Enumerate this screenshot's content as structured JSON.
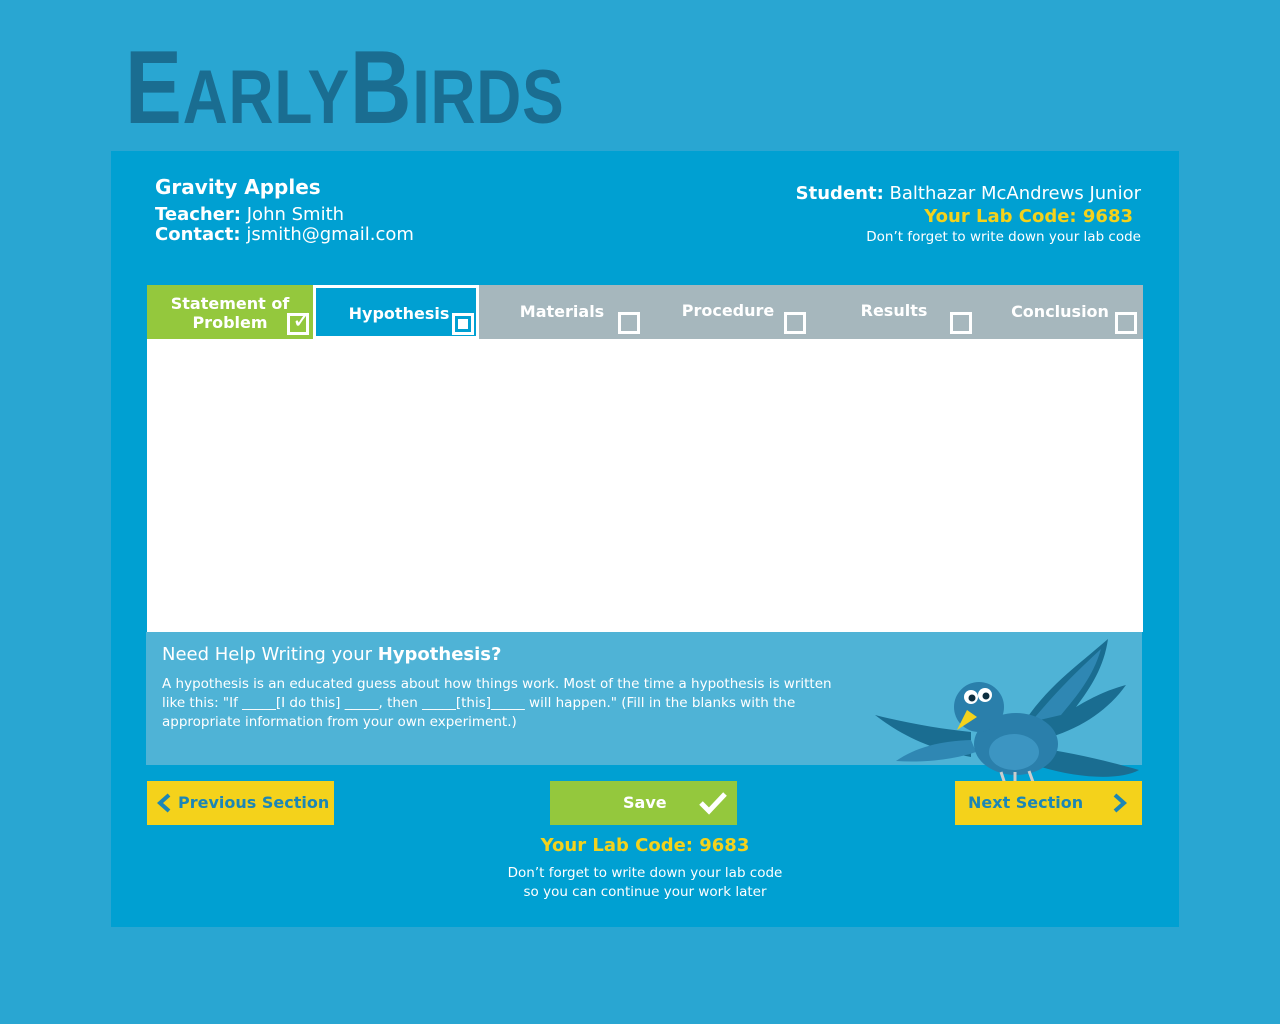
{
  "logo": {
    "part1_big": "E",
    "part1_small": "ARLY",
    "part2_big": "B",
    "part2_small": "IRDS"
  },
  "project": {
    "title": "Gravity Apples",
    "teacher_label": "Teacher:",
    "teacher_name": "John Smith",
    "contact_label": "Contact:",
    "contact_email": "jsmith@gmail.com"
  },
  "student": {
    "label": "Student:",
    "name": "Balthazar McAndrews Junior",
    "lab_code_label": "Your Lab Code: 9683",
    "reminder": "Don’t forget to write down your lab code"
  },
  "tabs": [
    {
      "label_line1": "Statement of",
      "label_line2": "Problem",
      "state": "complete"
    },
    {
      "label": "Hypothesis",
      "state": "active"
    },
    {
      "label": "Materials",
      "state": "incomplete"
    },
    {
      "label": "Procedure",
      "state": "incomplete"
    },
    {
      "label": "Results",
      "state": "incomplete"
    },
    {
      "label": "Conclusion",
      "state": "incomplete"
    }
  ],
  "help": {
    "title_prefix": "Need Help Writing your",
    "title_topic": "Hypothesis?",
    "text": "A hypothesis is an educated guess about how things work. Most of the time a hypothesis is written like this: \"If _____[I do this] _____, then _____[this]_____ will happen.\" (Fill in the blanks with the appropriate information from your own experiment.)"
  },
  "buttons": {
    "previous": "Previous Section",
    "save": "Save",
    "next": "Next Section"
  },
  "footer": {
    "lab_code": "Your Lab Code: 9683",
    "reminder_line1": "Don’t forget to write down your lab code",
    "reminder_line2": "so you can continue your work later"
  },
  "colors": {
    "background": "#29a6d2",
    "panel": "#00a0d2",
    "accent_yellow": "#f4d21b",
    "accent_green": "#94c83d",
    "tab_gray": "#a6b7bd",
    "logo": "#1a6d91"
  }
}
